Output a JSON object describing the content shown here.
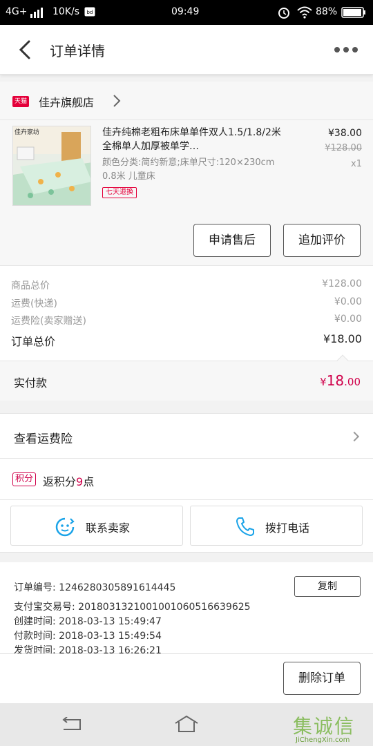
{
  "status": {
    "network": "4G+",
    "speed": "10K/s",
    "time": "09:49",
    "battery": "88%"
  },
  "header": {
    "title": "订单详情"
  },
  "store": {
    "badge": "天猫",
    "name": "佳卉旗舰店"
  },
  "product": {
    "thumb_label": "佳卉家纺",
    "name": "佳卉纯棉老粗布床单单件双人1.5/1.8/2米全棉单人加厚被单学…",
    "spec": "颜色分类:简约新意;床单尺寸:120×230cm 0.8米 儿童床",
    "badge": "七天退换",
    "price": "¥38.00",
    "original_price": "¥128.00",
    "quantity": "x1"
  },
  "actions": {
    "after_sale": "申请售后",
    "add_review": "追加评价"
  },
  "totals": {
    "items": [
      {
        "label": "商品总价",
        "value": "¥128.00"
      },
      {
        "label": "运费(快递)",
        "value": "¥0.00"
      },
      {
        "label": "运费险(卖家赠送)",
        "value": "¥0.00"
      }
    ],
    "order_total_label": "订单总价",
    "order_total_value": "¥18.00"
  },
  "paid": {
    "label": "实付款",
    "currency": "¥",
    "integer": "18",
    "decimal": ".00"
  },
  "shipping_insurance": {
    "label": "查看运费险"
  },
  "points": {
    "badge": "积分",
    "text_prefix": "返积分",
    "count": "9",
    "text_suffix": "点"
  },
  "contact": {
    "seller": "联系卖家",
    "call": "拨打电话"
  },
  "order_info": {
    "order_no": "订单编号: 1246280305891614445",
    "copy": "复制",
    "alipay_no": "支付宝交易号: 2018031321001001060516639625",
    "created": "创建时间: 2018-03-13 15:49:47",
    "paid_time": "付款时间: 2018-03-13 15:49:54",
    "shipped": "发货时间: 2018-03-13 16:26:21"
  },
  "footer": {
    "delete": "删除订单"
  },
  "watermark": {
    "text": "集诚信",
    "url": "JiChengXin.com"
  },
  "colors": {
    "accent": "#e4003a",
    "contact_icon": "#1aa3e8"
  }
}
